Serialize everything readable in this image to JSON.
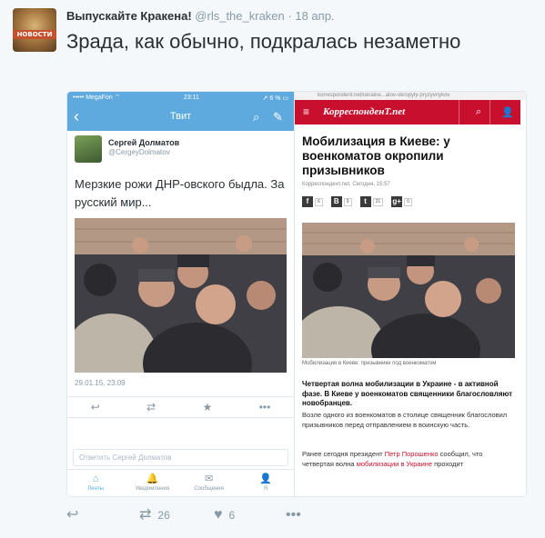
{
  "tweet": {
    "author_name": "Выпускайте Кракена!",
    "handle": "@rls_the_kraken",
    "separator": "·",
    "time": "18 апр.",
    "text": "Зрада, как обычно, подкралась незаметно",
    "avatar_label": "НОВОСТИ"
  },
  "phone": {
    "status": {
      "carrier": "••••• MegaFon ⌔",
      "clock": "23:11",
      "battery": "↗ 6 % ▭"
    },
    "nav": {
      "back": "‹",
      "title": "Твит",
      "search_icon": "⌕",
      "compose_icon": "✎"
    },
    "user": {
      "name": "Сергей Долматов",
      "handle": "@CergeyDolmatov"
    },
    "text": "Мерзкие рожи ДНР-овского быдла. За русский мир...",
    "date": "29.01.15, 23:09",
    "actions": [
      "↩",
      "⇄",
      "★",
      "•••"
    ],
    "reply_placeholder": "Ответить Сергей Долматов",
    "tabs": [
      {
        "icon": "⌂",
        "label": "Ленты"
      },
      {
        "icon": "🔔",
        "label": "Уведомления"
      },
      {
        "icon": "✉",
        "label": "Сообщения"
      },
      {
        "icon": "👤",
        "label": "Я"
      }
    ]
  },
  "site": {
    "url": "korrespondent.net/ukraine...atov-okropyly-pryzyvnykov",
    "logo": "КорреспонденТ.net",
    "menu_icon": "≡",
    "search_icon": "⌕",
    "user_icon": "👤",
    "headline": "Мобилизация в Киеве: у военкоматов окропили призывников",
    "meta": "Корреспондент.net, Сегодня, 15:57",
    "share": [
      {
        "icon": "f",
        "count": "6"
      },
      {
        "icon": "В",
        "count": "9"
      },
      {
        "icon": "t",
        "count": "21"
      },
      {
        "icon": "g+",
        "count": "0"
      }
    ],
    "caption": "Мобилизация в Киеве: призывники под военкоматом",
    "lead": "Четвертая волна мобилизации в Украине - в активной фазе. В Киеве у военкоматов священники благословляют новобранцев.",
    "p1": "Возле одного из военкоматов в столице священник благословил призывников перед отправлением в воинскую часть.",
    "p2_before": "Ранее сегодня президент ",
    "p2_link1": "Петр Порошенко",
    "p2_mid": " сообщил, что четвертая волна ",
    "p2_link2": "мобилизации в Украине",
    "p2_after": " проходит"
  },
  "actions": {
    "reply_icon": "↩",
    "retweet_icon": "⇄",
    "retweet_count": "26",
    "like_icon": "♥",
    "like_count": "6",
    "more_icon": "•••"
  },
  "colors": {
    "twitter_blue": "#5ea9dd",
    "korr_red": "#c8102e",
    "text_gray": "#8899a6"
  }
}
